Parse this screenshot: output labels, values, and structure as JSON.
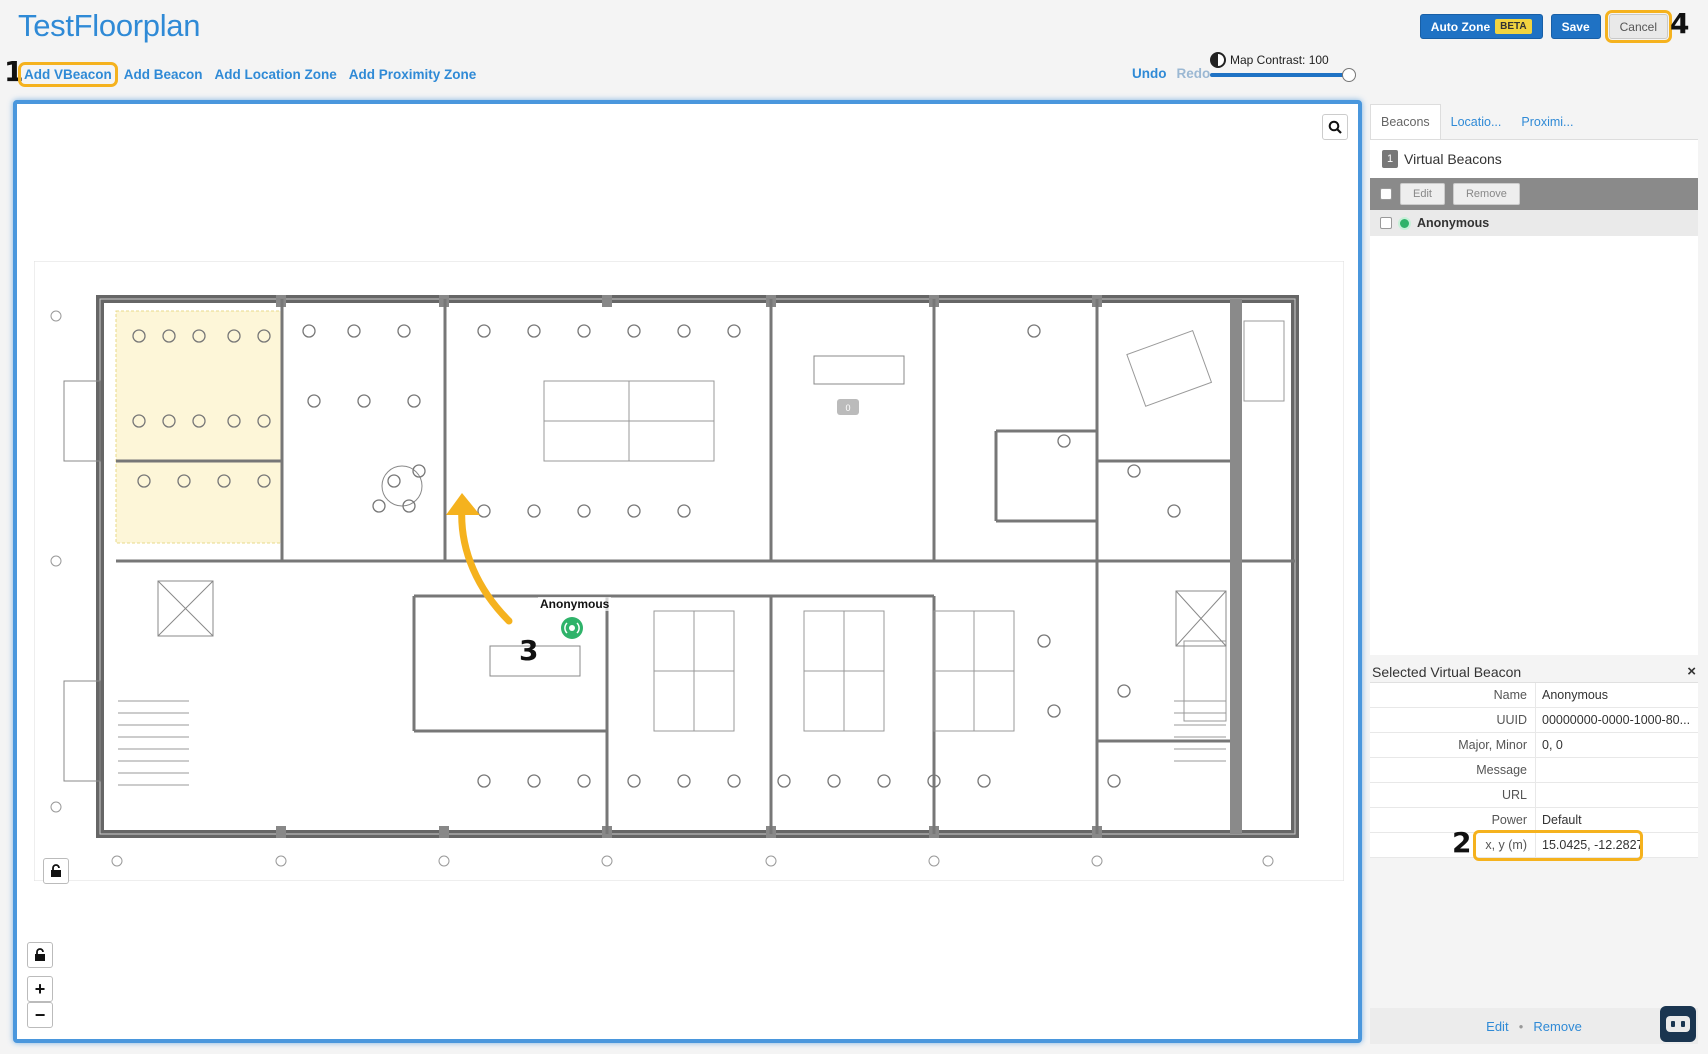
{
  "page": {
    "title": "TestFloorplan"
  },
  "toolbar": {
    "auto_zone_label": "Auto Zone",
    "beta_label": "BETA",
    "save_label": "Save",
    "cancel_label": "Cancel",
    "add_links": [
      "Add VBeacon",
      "Add Beacon",
      "Add Location Zone",
      "Add Proximity Zone"
    ],
    "undo_label": "Undo",
    "redo_label": "Redo",
    "contrast_label": "Map Contrast: 100",
    "contrast_value": 100
  },
  "steps": [
    "1",
    "2",
    "3",
    "4"
  ],
  "map": {
    "beacon_name": "Anonymous",
    "room_count_badge": "0"
  },
  "right_panel": {
    "tabs": [
      "Beacons",
      "Locatio...",
      "Proximi..."
    ],
    "list": {
      "count": "1",
      "title": "Virtual Beacons",
      "edit_label": "Edit",
      "remove_label": "Remove",
      "items": [
        {
          "name": "Anonymous"
        }
      ]
    },
    "detail": {
      "title": "Selected Virtual Beacon",
      "close_symbol": "×",
      "rows": [
        {
          "key": "Name",
          "value": "Anonymous"
        },
        {
          "key": "UUID",
          "value": "00000000-0000-1000-80..."
        },
        {
          "key": "Major, Minor",
          "value": "0, 0"
        },
        {
          "key": "Message",
          "value": ""
        },
        {
          "key": "URL",
          "value": ""
        },
        {
          "key": "Power",
          "value": "Default"
        },
        {
          "key": "x, y (m)",
          "value": "15.0425, -12.2827"
        }
      ],
      "edit_label": "Edit",
      "remove_label": "Remove"
    }
  },
  "colors": {
    "accent": "#2f8ad6",
    "highlight": "#f5b21e",
    "beacon_green": "#2fb36a",
    "zone_fill": "#fdf6d8"
  },
  "icons": [
    "search-icon",
    "contrast-icon",
    "unlock-icon",
    "zoom-in-icon",
    "zoom-out-icon",
    "beacon-icon",
    "close-icon",
    "chat-bot-icon"
  ]
}
